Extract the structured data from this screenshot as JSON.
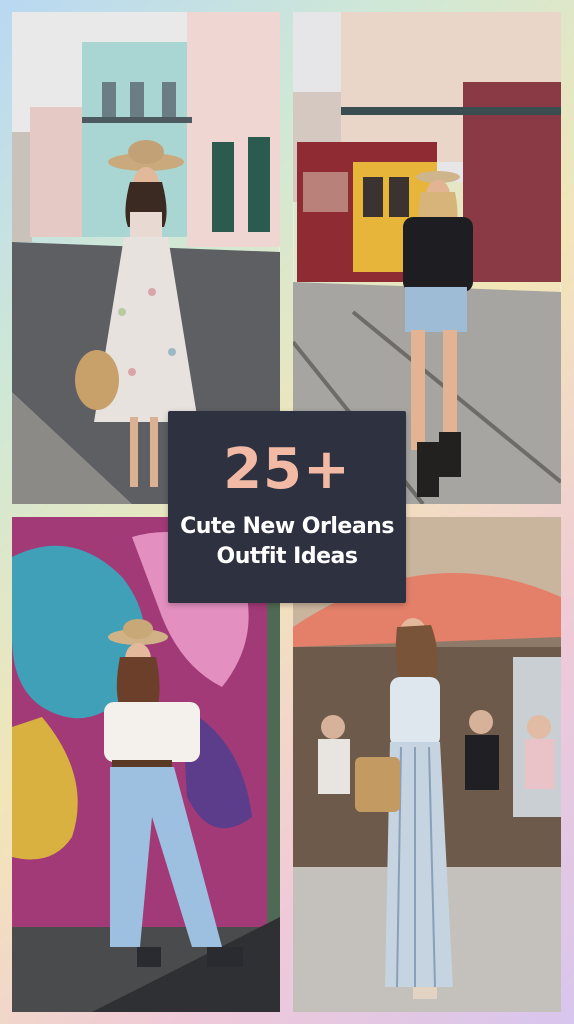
{
  "title_card": {
    "number": "25+",
    "line1": "Cute New Orleans",
    "line2": "Outfit Ideas"
  },
  "colors": {
    "card_background": "#2d3140",
    "number_color": "#f2b9a4",
    "text_color": "#ffffff"
  }
}
